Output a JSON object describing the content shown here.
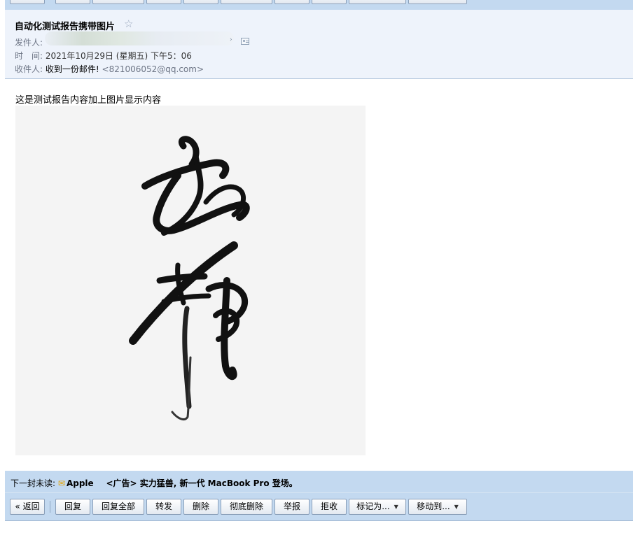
{
  "toolbar": {
    "back": "« 返回",
    "reply": "回复",
    "reply_all": "回复全部",
    "forward": "转发",
    "delete": "删除",
    "delete_permanently": "彻底删除",
    "report": "举报",
    "reject": "拒收",
    "mark_as": "标记为...",
    "move_to": "移动到..."
  },
  "mail": {
    "subject": "自动化测试报告携带图片",
    "star": "☆",
    "from_label": "发件人:",
    "time_label": "时　间:",
    "time_value": "2021年10月29日 (星期五) 下午5：06",
    "to_label": "收件人:",
    "to_name": "收到一份邮件!",
    "to_email": "<821006052@qq.com>"
  },
  "content": {
    "body_text": "这是测试报告内容加上图片显示内容"
  },
  "next_unread": {
    "label": "下一封未读:",
    "sender": "Apple",
    "subject": "<广告> 实力猛兽, 新一代 MacBook Pro 登场。"
  }
}
